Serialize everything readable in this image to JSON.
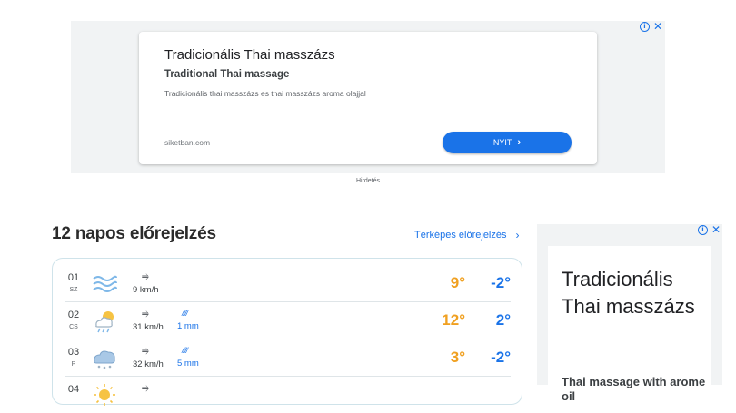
{
  "top_ad": {
    "title": "Tradicionális Thai masszázs",
    "subtitle": "Traditional Thai massage",
    "description": "Tradicionális thai masszázs es thai masszázs aroma olajjal",
    "domain": "siketban.com",
    "button_label": "NYIT",
    "ad_label": "Hirdetés"
  },
  "forecast": {
    "title": "12 napos előrejelzés",
    "map_link": "Térképes előrejelzés",
    "rows": [
      {
        "day": "01",
        "abbr": "SZ",
        "icon": "wind-icon",
        "wind_speed": "9 km/h",
        "rain": "",
        "tmax": "9°",
        "tmin": "-2°"
      },
      {
        "day": "02",
        "abbr": "CS",
        "icon": "sun-rain-icon",
        "wind_speed": "31 km/h",
        "rain": "1 mm",
        "tmax": "12°",
        "tmin": "2°"
      },
      {
        "day": "03",
        "abbr": "P",
        "icon": "snow-cloud-icon",
        "wind_speed": "32 km/h",
        "rain": "5 mm",
        "tmax": "3°",
        "tmin": "-2°"
      },
      {
        "day": "04",
        "abbr": "",
        "icon": "sun-icon",
        "wind_speed": "",
        "rain": "",
        "tmax": "",
        "tmin": ""
      }
    ]
  },
  "right_ad": {
    "title": "Tradicionális Thai masszázs",
    "subtitle": "Thai massage with arome oil"
  },
  "colors": {
    "accent": "#1a73e8",
    "max_temp": "#f0a020",
    "ad_background": "#f1f3f4"
  }
}
